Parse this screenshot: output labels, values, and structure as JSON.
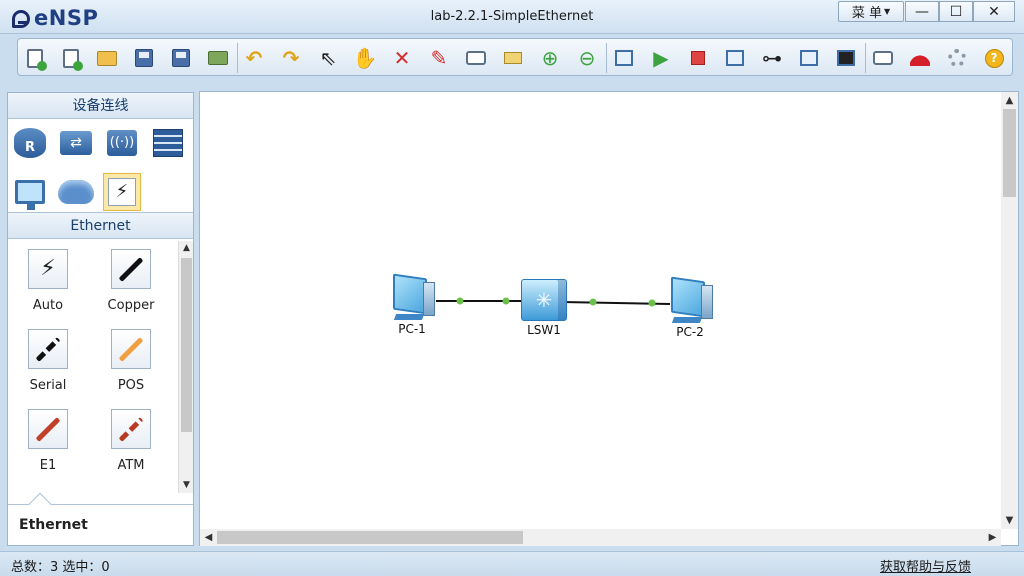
{
  "app": {
    "name": "eNSP",
    "window_title": "lab-2.2.1-SimpleEthernet"
  },
  "window_controls": {
    "menu_label": "菜 单",
    "minimize": "—",
    "maximize": "☐",
    "close": "✕"
  },
  "toolbar": {
    "groups": [
      [
        "new-topology",
        "new-example",
        "open",
        "save",
        "save-as",
        "print"
      ],
      [
        "undo",
        "redo",
        "select",
        "pan",
        "delete",
        "delete-link",
        "text",
        "palette",
        "zoom-in",
        "zoom-out"
      ],
      [
        "start-all",
        "start",
        "stop",
        "capture",
        "topology",
        "list",
        "terminal"
      ],
      [
        "chat",
        "huawei",
        "settings",
        "help"
      ]
    ]
  },
  "left_panel": {
    "title": "设备连线",
    "categories": [
      {
        "icon": "router-icon",
        "label": "R"
      },
      {
        "icon": "switch-icon"
      },
      {
        "icon": "wireless-icon"
      },
      {
        "icon": "firewall-icon"
      },
      {
        "icon": "pc-icon"
      },
      {
        "icon": "cloud-icon"
      },
      {
        "icon": "link-icon",
        "selected": true
      }
    ],
    "subcategory": "Ethernet",
    "cables": [
      {
        "label": "Auto",
        "icon": "auto-link-icon",
        "color": "#111111"
      },
      {
        "label": "Copper",
        "icon": "copper-link-icon",
        "color": "#111111"
      },
      {
        "label": "Serial",
        "icon": "serial-link-icon",
        "color": "#111111"
      },
      {
        "label": "POS",
        "icon": "pos-link-icon",
        "color": "#f0a040"
      },
      {
        "label": "E1",
        "icon": "e1-link-icon",
        "color": "#c0402a"
      },
      {
        "label": "ATM",
        "icon": "atm-link-icon",
        "color": "#b83a22"
      }
    ],
    "description_title": "Ethernet"
  },
  "topology": {
    "devices": [
      {
        "name": "PC-1",
        "type": "pc"
      },
      {
        "name": "LSW1",
        "type": "switch"
      },
      {
        "name": "PC-2",
        "type": "pc"
      }
    ],
    "links": [
      {
        "from": "PC-1",
        "to": "LSW1",
        "status": "up",
        "port_color": "#6ac04a"
      },
      {
        "from": "LSW1",
        "to": "PC-2",
        "status": "up",
        "port_color": "#6ac04a"
      }
    ]
  },
  "status_bar": {
    "left": "总数：3 选中：0",
    "right": "获取帮助与反馈"
  }
}
